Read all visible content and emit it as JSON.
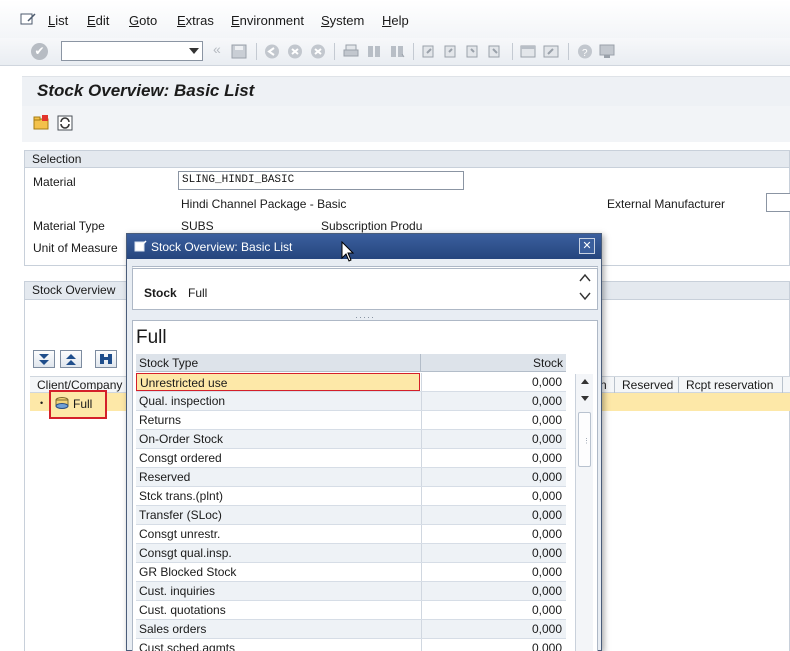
{
  "menu": {
    "items": [
      "List",
      "Edit",
      "Goto",
      "Extras",
      "Environment",
      "System",
      "Help"
    ]
  },
  "page": {
    "title": "Stock Overview: Basic List"
  },
  "selection": {
    "header": "Selection",
    "material_label": "Material",
    "material_value": "SLING_HINDI_BASIC",
    "material_desc": "Hindi Channel Package - Basic",
    "ext_manufacturer_label": "External Manufacturer",
    "material_type_label": "Material Type",
    "material_type_value": "SUBS",
    "material_type_desc": "Subscription Produ",
    "uom_label": "Unit of Measure"
  },
  "stock_overview": {
    "header": "Stock Overview",
    "col_client": "Client/Company",
    "col_n": "n",
    "col_reserved": "Reserved",
    "col_rcpt": "Rcpt reservation",
    "node_label": "Full"
  },
  "popup": {
    "title": "Stock Overview: Basic List",
    "close": "✕",
    "head_label": "Stock",
    "head_value": "Full",
    "section_title": "Full",
    "col_type": "Stock Type",
    "col_stock": "Stock",
    "rows": [
      {
        "type": "Unrestricted use",
        "stock": "0,000"
      },
      {
        "type": "Qual. inspection",
        "stock": "0,000"
      },
      {
        "type": "Returns",
        "stock": "0,000"
      },
      {
        "type": "On-Order Stock",
        "stock": "0,000"
      },
      {
        "type": "Consgt ordered",
        "stock": "0,000"
      },
      {
        "type": "Reserved",
        "stock": "0,000"
      },
      {
        "type": "Stck trans.(plnt)",
        "stock": "0,000"
      },
      {
        "type": "Transfer (SLoc)",
        "stock": "0,000"
      },
      {
        "type": "Consgt unrestr.",
        "stock": "0,000"
      },
      {
        "type": "Consgt qual.insp.",
        "stock": "0,000"
      },
      {
        "type": "GR Blocked Stock",
        "stock": "0,000"
      },
      {
        "type": "Cust. inquiries",
        "stock": "0,000"
      },
      {
        "type": "Cust. quotations",
        "stock": "0,000"
      },
      {
        "type": "Sales orders",
        "stock": "0,000"
      },
      {
        "type": "Cust.sched.agmts",
        "stock": "0,000"
      }
    ]
  }
}
